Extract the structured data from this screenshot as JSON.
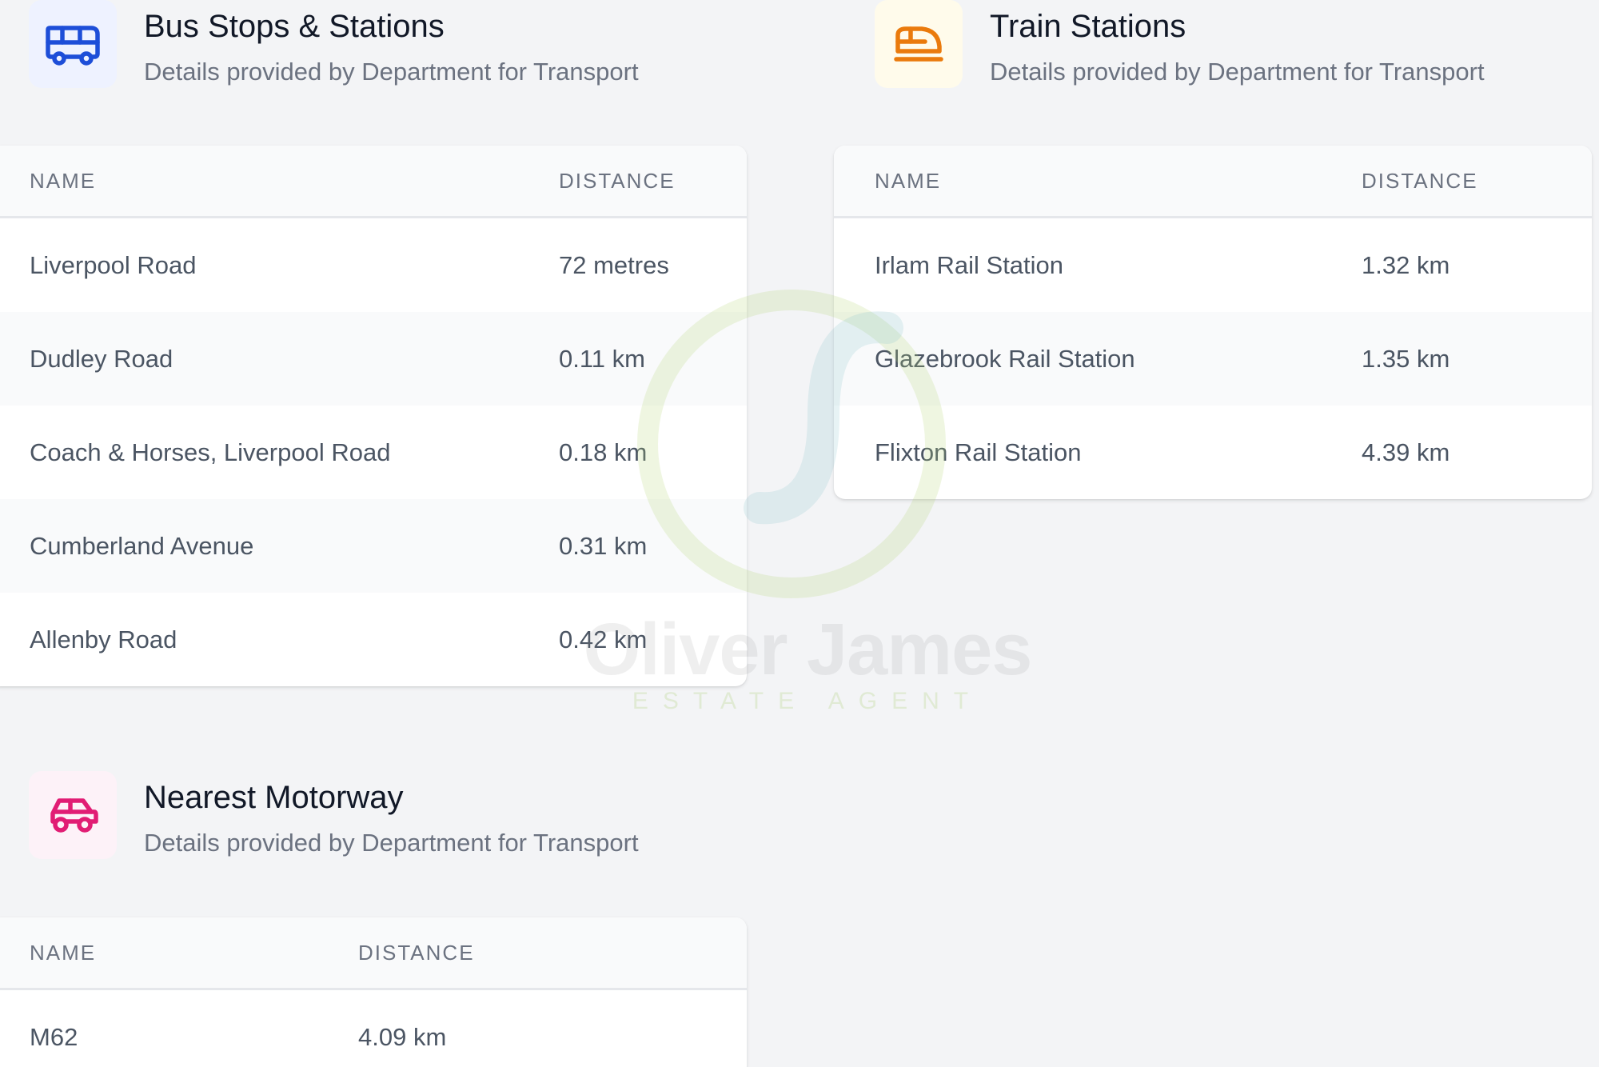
{
  "bus": {
    "title": "Bus Stops & Stations",
    "subtitle": "Details provided by Department for Transport",
    "icon": "bus-icon",
    "accent": "#1d4ed8",
    "icon_bg": "#eef2ff",
    "columns": [
      "NAME",
      "DISTANCE"
    ],
    "rows": [
      {
        "name": "Liverpool Road",
        "distance": "72 metres"
      },
      {
        "name": "Dudley Road",
        "distance": "0.11 km"
      },
      {
        "name": "Coach & Horses, Liverpool Road",
        "distance": "0.18 km"
      },
      {
        "name": "Cumberland Avenue",
        "distance": "0.31 km"
      },
      {
        "name": "Allenby Road",
        "distance": "0.42 km"
      }
    ]
  },
  "train": {
    "title": "Train Stations",
    "subtitle": "Details provided by Department for Transport",
    "icon": "train-icon",
    "accent": "#ea7a0c",
    "icon_bg": "#fffbeb",
    "columns": [
      "NAME",
      "DISTANCE"
    ],
    "rows": [
      {
        "name": "Irlam Rail Station",
        "distance": "1.32 km"
      },
      {
        "name": "Glazebrook Rail Station",
        "distance": "1.35 km"
      },
      {
        "name": "Flixton Rail Station",
        "distance": "4.39 km"
      }
    ]
  },
  "motorway": {
    "title": "Nearest Motorway",
    "subtitle": "Details provided by Department for Transport",
    "icon": "car-icon",
    "accent": "#e11d74",
    "icon_bg": "#fdf2f8",
    "columns": [
      "NAME",
      "DISTANCE"
    ],
    "rows": [
      {
        "name": "M62",
        "distance": "4.09 km"
      }
    ]
  },
  "watermark": {
    "name": "Oliver James",
    "tagline": "ESTATE AGENT"
  }
}
